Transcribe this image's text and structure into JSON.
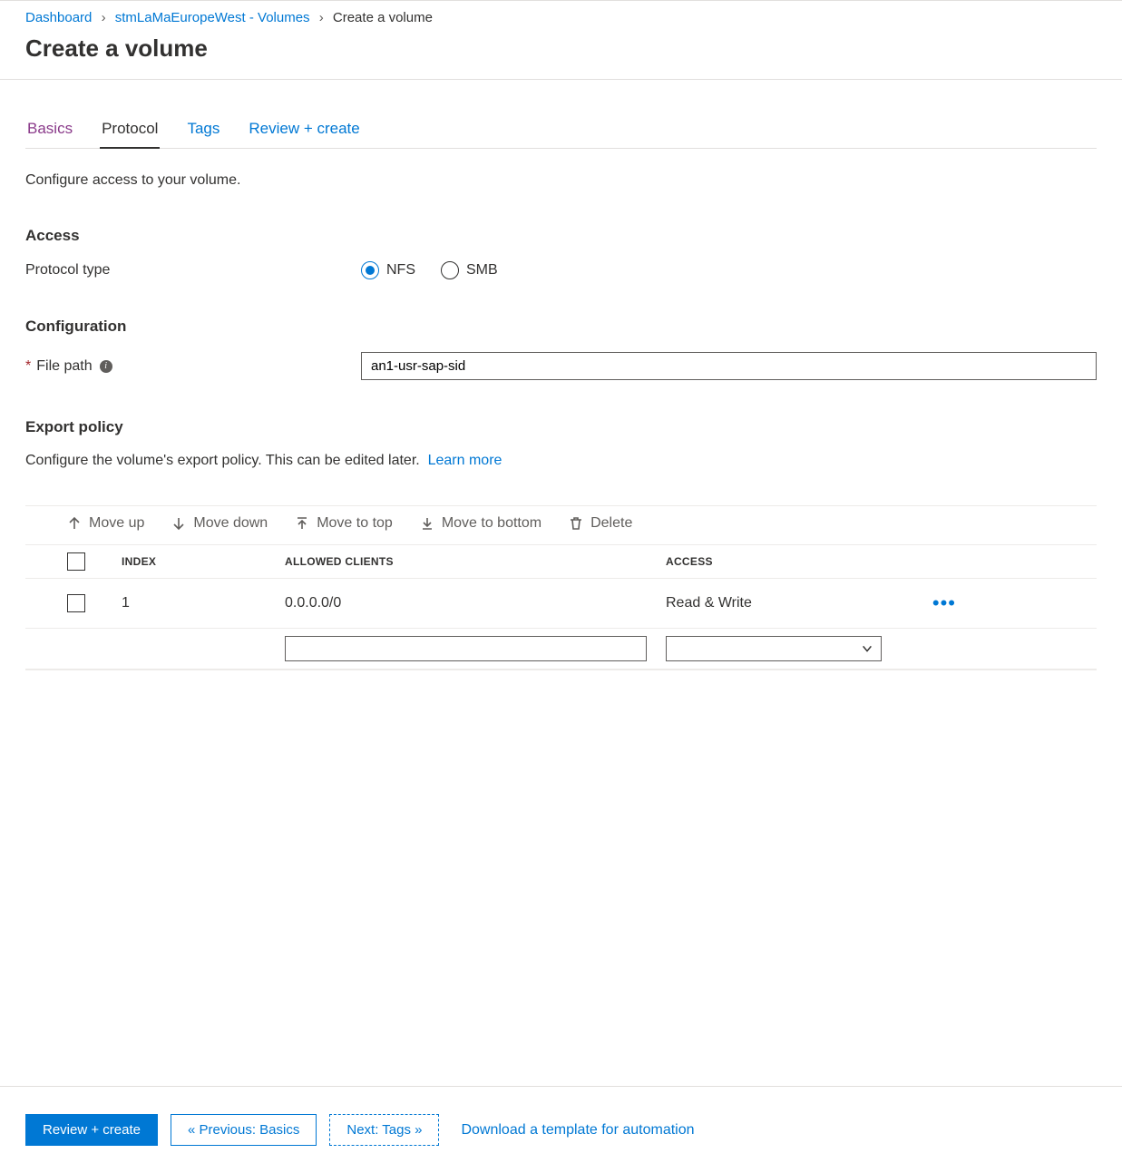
{
  "breadcrumb": {
    "dashboard": "Dashboard",
    "parent": "stmLaMaEuropeWest - Volumes",
    "current": "Create a volume"
  },
  "page_title": "Create a volume",
  "tabs": {
    "basics": "Basics",
    "protocol": "Protocol",
    "tags": "Tags",
    "review": "Review + create"
  },
  "desc": "Configure access to your volume.",
  "access": {
    "heading": "Access",
    "protocol_label": "Protocol type",
    "nfs": "NFS",
    "smb": "SMB"
  },
  "config": {
    "heading": "Configuration",
    "file_path_label": "File path",
    "file_path_value": "an1-usr-sap-sid"
  },
  "export": {
    "heading": "Export policy",
    "desc": "Configure the volume's export policy. This can be edited later.",
    "learn_more": "Learn more"
  },
  "toolbar": {
    "move_up": "Move up",
    "move_down": "Move down",
    "move_top": "Move to top",
    "move_bottom": "Move to bottom",
    "delete": "Delete"
  },
  "table": {
    "head_index": "INDEX",
    "head_allowed": "ALLOWED CLIENTS",
    "head_access": "ACCESS",
    "row_index": "1",
    "row_allowed": "0.0.0.0/0",
    "row_access": "Read & Write"
  },
  "footer": {
    "review": "Review + create",
    "prev": "« Previous: Basics",
    "next": "Next: Tags »",
    "download": "Download a template for automation"
  }
}
